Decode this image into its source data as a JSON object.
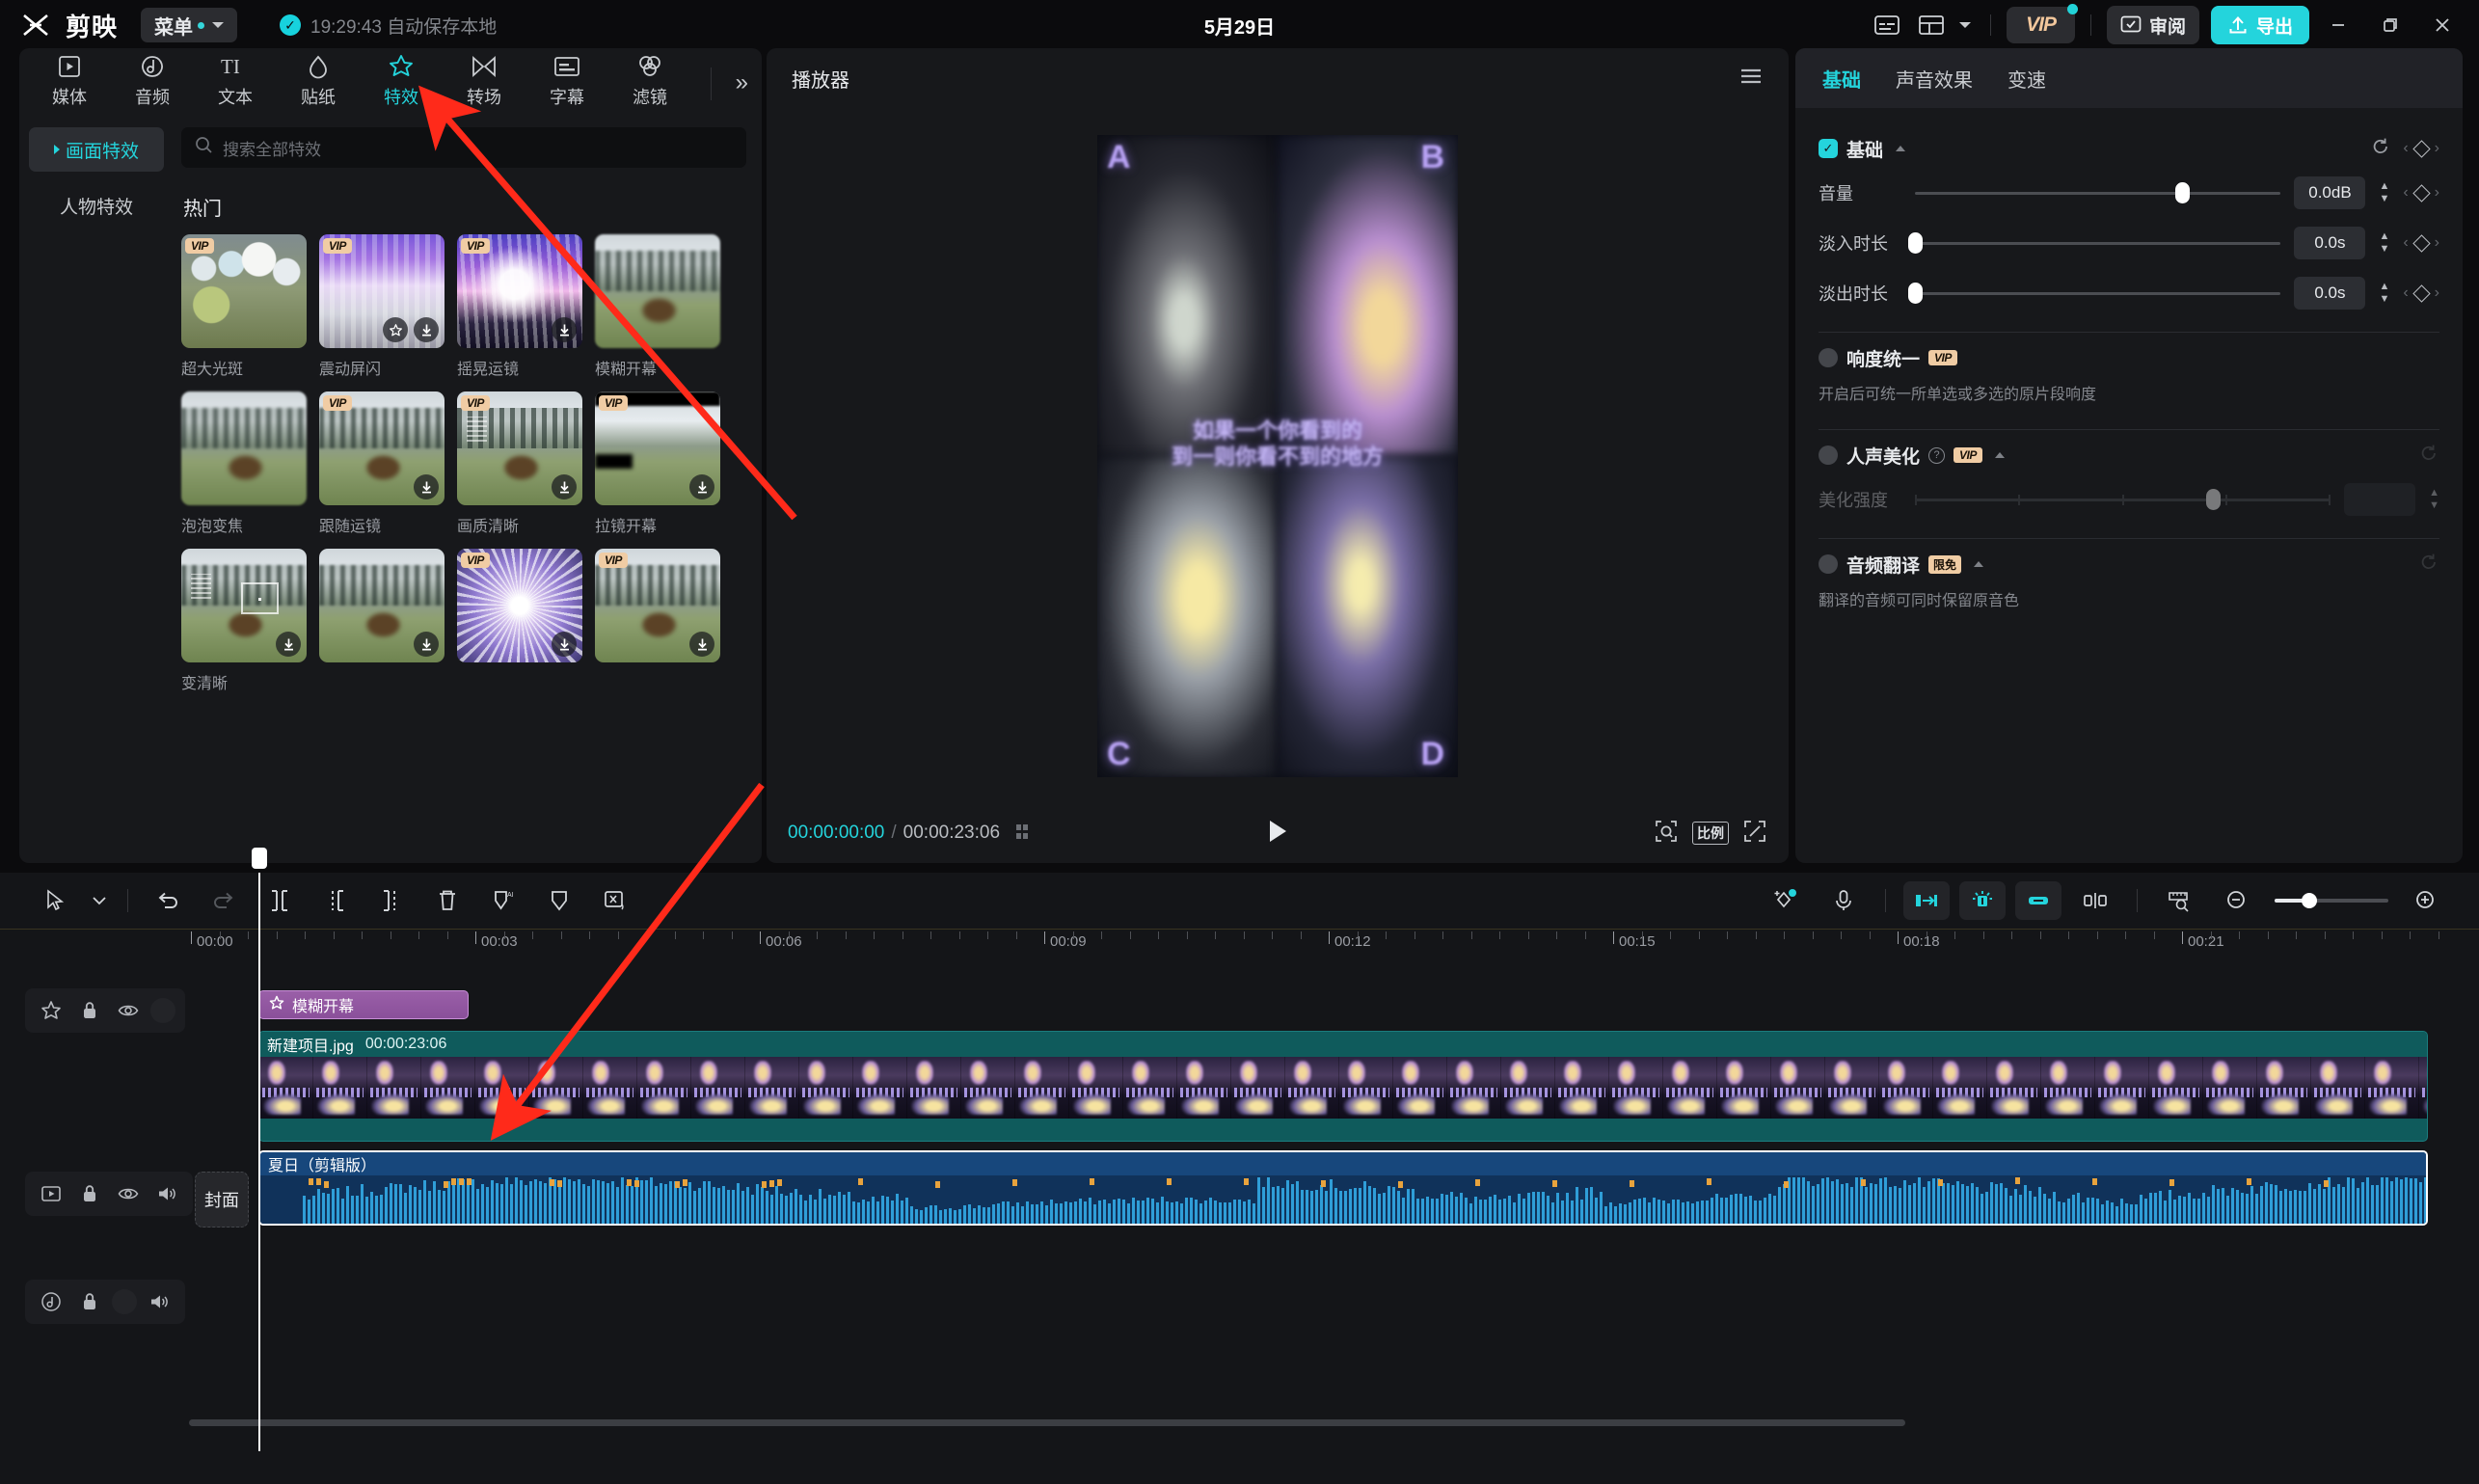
{
  "titlebar": {
    "app_name": "剪映",
    "menu_label": "菜单",
    "autosave_text": "19:29:43 自动保存本地",
    "project_title": "5月29日",
    "vip_label": "VIP",
    "review_label": "审阅",
    "export_label": "导出",
    "icons": {
      "logo": "jianying-logo-icon",
      "check": "autosave-check-icon",
      "subtitle": "caption-icon",
      "layout": "layout-icon",
      "minimize": "minimize-icon",
      "maximize": "maximize-icon",
      "close": "close-icon"
    }
  },
  "left_panel": {
    "tabs": [
      {
        "label": "媒体",
        "icon": "media-icon",
        "active": false
      },
      {
        "label": "音频",
        "icon": "audio-icon",
        "active": false
      },
      {
        "label": "文本",
        "icon": "text-icon",
        "active": false
      },
      {
        "label": "贴纸",
        "icon": "sticker-icon",
        "active": false
      },
      {
        "label": "特效",
        "icon": "effects-icon",
        "active": true
      },
      {
        "label": "转场",
        "icon": "transition-icon",
        "active": false
      },
      {
        "label": "字幕",
        "icon": "subtitle-icon",
        "active": false
      },
      {
        "label": "滤镜",
        "icon": "filter-icon",
        "active": false
      }
    ],
    "more_label": "»",
    "categories": [
      {
        "label": "画面特效",
        "active": true
      },
      {
        "label": "人物特效",
        "active": false
      }
    ],
    "search_placeholder": "搜索全部特效",
    "section_title": "热门",
    "effects": [
      {
        "name": "超大光斑",
        "vip": true,
        "download": false,
        "favorite": false,
        "art": "t-bokeh"
      },
      {
        "name": "震动屏闪",
        "vip": true,
        "download": true,
        "favorite": true,
        "art": "t-aurora"
      },
      {
        "name": "摇晃运镜",
        "vip": true,
        "download": true,
        "favorite": false,
        "art": "t-shake"
      },
      {
        "name": "模糊开幕",
        "vip": false,
        "download": false,
        "favorite": false,
        "art": "t-elk t-elk-blur"
      },
      {
        "name": "泡泡变焦",
        "vip": false,
        "download": false,
        "favorite": false,
        "art": "t-elk t-elk-blur"
      },
      {
        "name": "跟随运镜",
        "vip": true,
        "download": true,
        "favorite": false,
        "art": "t-elk"
      },
      {
        "name": "画质清晰",
        "vip": true,
        "download": true,
        "favorite": false,
        "art": "t-elk t-elk-sharp"
      },
      {
        "name": "拉镜开幕",
        "vip": true,
        "download": true,
        "favorite": false,
        "art": "t-elk t-letterbox"
      },
      {
        "name": "变清晰",
        "vip": false,
        "download": true,
        "favorite": false,
        "art": "t-elk"
      },
      {
        "name": "",
        "vip": false,
        "download": true,
        "favorite": false,
        "art": "t-elk"
      },
      {
        "name": "",
        "vip": true,
        "download": true,
        "favorite": false,
        "art": "t-rays"
      },
      {
        "name": "",
        "vip": true,
        "download": true,
        "favorite": false,
        "art": "t-elk"
      }
    ]
  },
  "player": {
    "title": "播放器",
    "menu_icon": "hamburger-icon",
    "current_time": "00:00:00:00",
    "time_separator": "/",
    "total_time": "00:00:23:06",
    "caption_line1": "如果一个你看到的",
    "caption_line2": "到一则你看不到的地方",
    "quadrant_labels": [
      "A",
      "B",
      "C",
      "D"
    ],
    "play_icon": "play-icon",
    "ratio_label": "比例",
    "zoom_icon": "zoom-fit-icon",
    "fullscreen_icon": "fullscreen-icon",
    "grid_icon": "grid-icon"
  },
  "right_panel": {
    "tabs": [
      {
        "label": "基础",
        "active": true
      },
      {
        "label": "声音效果",
        "active": false
      },
      {
        "label": "变速",
        "active": false
      }
    ],
    "basic_group": {
      "title": "基础",
      "enabled": true,
      "reset_icon": "reset-icon",
      "keyframe_icon": "keyframe-diamond-icon"
    },
    "params": [
      {
        "label": "音量",
        "value": "0.0dB",
        "knob_pct": 73
      },
      {
        "label": "淡入时长",
        "value": "0.0s",
        "knob_pct": 0
      },
      {
        "label": "淡出时长",
        "value": "0.0s",
        "knob_pct": 0
      }
    ],
    "loudness": {
      "title": "响度统一",
      "badge": "VIP",
      "enabled": false,
      "desc": "开启后可统一所单选或多选的原片段响度"
    },
    "voice_beauty": {
      "title": "人声美化",
      "badge": "VIP",
      "enabled": false,
      "help_icon": "help-icon",
      "slider_label": "美化强度",
      "knob_pct": 72
    },
    "audio_translate": {
      "title": "音频翻译",
      "badge": "限免",
      "enabled": false,
      "desc": "翻译的音频可同时保留原音色"
    }
  },
  "timeline": {
    "tools_left": [
      {
        "name": "select-tool",
        "icon": "cursor-icon"
      },
      {
        "name": "select-dropdown",
        "icon": "chevron-down-icon"
      },
      {
        "name": "undo",
        "icon": "undo-icon",
        "dimmed": false
      },
      {
        "name": "redo",
        "icon": "redo-icon",
        "dimmed": true
      },
      {
        "name": "split",
        "icon": "split-icon"
      },
      {
        "name": "trim-left",
        "icon": "trim-left-icon"
      },
      {
        "name": "trim-right",
        "icon": "trim-right-icon"
      },
      {
        "name": "delete",
        "icon": "trash-icon"
      },
      {
        "name": "ai-mark",
        "icon": "ai-shield-icon"
      },
      {
        "name": "mark",
        "icon": "shield-icon"
      },
      {
        "name": "audio-detach",
        "icon": "detach-audio-icon"
      }
    ],
    "tools_right": [
      {
        "name": "auto-keyframe",
        "icon": "magic-keyframe-icon"
      },
      {
        "name": "record",
        "icon": "microphone-icon"
      },
      {
        "name": "snap-left",
        "icon": "snap-left-icon",
        "active": true
      },
      {
        "name": "snap-mid",
        "icon": "magnet-icon",
        "active": true
      },
      {
        "name": "link",
        "icon": "link-icon",
        "active": true
      },
      {
        "name": "gap-close",
        "icon": "gap-icon",
        "active": false
      },
      {
        "name": "preview-scale",
        "icon": "ruler-icon",
        "active": false
      },
      {
        "name": "zoom-out",
        "icon": "zoom-out-icon"
      },
      {
        "name": "zoom-slider",
        "icon": "zoom-slider"
      },
      {
        "name": "zoom-in",
        "icon": "zoom-in-icon"
      }
    ],
    "ruler_labels": [
      "00:00",
      "00:03",
      "00:06",
      "00:09",
      "00:12",
      "00:15",
      "00:18",
      "00:21"
    ],
    "cover_label": "封面",
    "tracks": [
      {
        "type": "effect",
        "head_icons": [
          "effect-star-icon",
          "lock-icon",
          "eye-icon",
          "blank-icon"
        ],
        "clip": {
          "label": "模糊开幕",
          "icon": "effect-star-icon"
        }
      },
      {
        "type": "video",
        "head_icons": [
          "video-icon",
          "lock-icon",
          "eye-icon",
          "speaker-icon"
        ],
        "clip": {
          "name": "新建项目.jpg",
          "duration": "00:00:23:06"
        }
      },
      {
        "type": "audio",
        "head_icons": [
          "music-icon",
          "lock-icon",
          "blank-icon",
          "speaker-icon"
        ],
        "clip": {
          "name": "夏日（剪辑版）"
        }
      }
    ]
  },
  "colors": {
    "accent": "#24d4dc",
    "vip_gold": "#f0cca4",
    "effect_clip": "#9a5fa8",
    "video_clip": "#0f5b5c",
    "audio_clip": "#123a66",
    "annotation_arrow": "#ff2a1a"
  }
}
